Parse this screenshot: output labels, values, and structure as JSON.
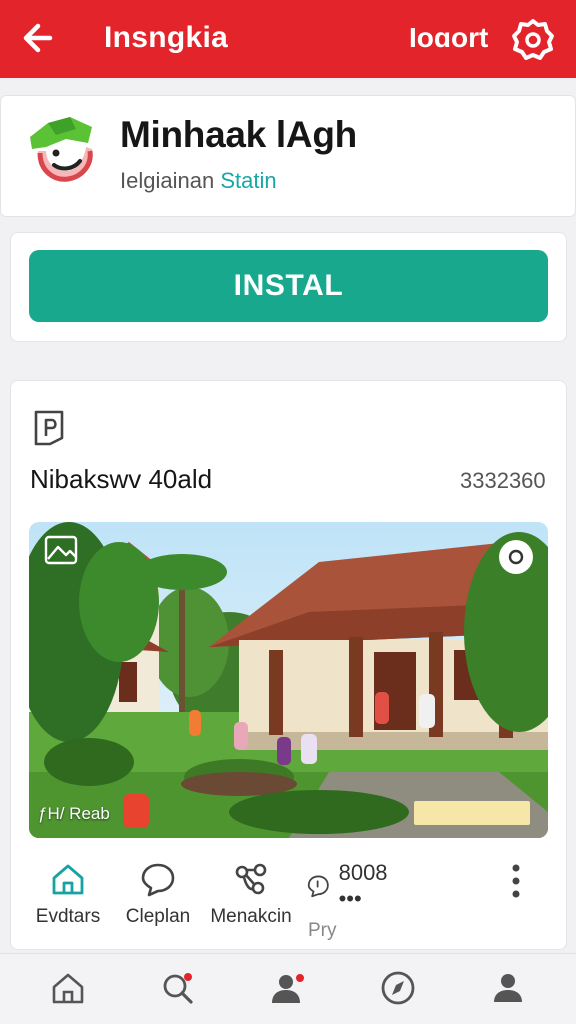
{
  "header": {
    "title": "Insngkia",
    "import_label": "Ioɑort",
    "icons": {
      "back": "back-arrow-icon",
      "settings": "gear-icon"
    },
    "color": "#e3242b"
  },
  "app": {
    "name": "Minhaak lAgh",
    "subtitle_plain": "Ielgiainan",
    "subtitle_accent": "Statin",
    "logo_icon": "app-logo-icon"
  },
  "install": {
    "label": "INSTAL",
    "color": "#17a88e"
  },
  "post": {
    "tag_icon": "tag-icon",
    "title": "Nibakswv 40ald",
    "count": "3332360",
    "photo_caption": "ƒH/ Reab"
  },
  "actions": [
    {
      "icon": "home-icon",
      "label": "Evdtars"
    },
    {
      "icon": "chat-bubble-icon",
      "label": "Cleplan"
    },
    {
      "icon": "share-icon",
      "label": "Menakcin"
    },
    {
      "icon": "comment-icon",
      "label": "Pry",
      "count": "8008 •••"
    }
  ],
  "bottom_nav": [
    {
      "icon": "home-icon"
    },
    {
      "icon": "search-icon"
    },
    {
      "icon": "people-icon"
    },
    {
      "icon": "compass-icon"
    },
    {
      "icon": "profile-icon"
    }
  ]
}
